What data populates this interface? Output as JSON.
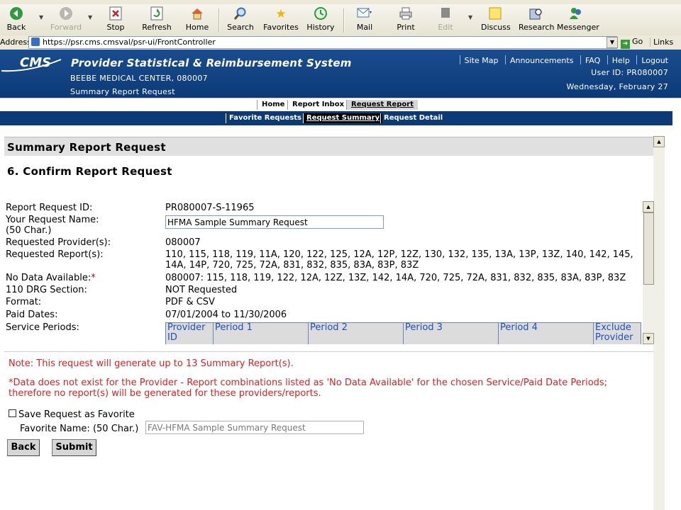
{
  "browser": {
    "toolbar": [
      {
        "label": "Back",
        "icon": "back-arrow-icon",
        "enabled": true
      },
      {
        "label": "Forward",
        "icon": "forward-arrow-icon",
        "enabled": false
      },
      {
        "label": "Stop",
        "icon": "stop-icon",
        "enabled": true
      },
      {
        "label": "Refresh",
        "icon": "refresh-icon",
        "enabled": true
      },
      {
        "label": "Home",
        "icon": "home-icon",
        "enabled": true
      },
      {
        "label": "Search",
        "icon": "search-icon",
        "enabled": true
      },
      {
        "label": "Favorites",
        "icon": "star-icon",
        "enabled": true
      },
      {
        "label": "History",
        "icon": "history-icon",
        "enabled": true
      },
      {
        "label": "Mail",
        "icon": "mail-icon",
        "enabled": true
      },
      {
        "label": "Print",
        "icon": "printer-icon",
        "enabled": true
      },
      {
        "label": "Edit",
        "icon": "edit-icon",
        "enabled": false
      },
      {
        "label": "Discuss",
        "icon": "discuss-icon",
        "enabled": true
      },
      {
        "label": "Research",
        "icon": "research-icon",
        "enabled": true
      },
      {
        "label": "Messenger",
        "icon": "messenger-icon",
        "enabled": true
      }
    ],
    "address_label": "Address",
    "url": "https://psr.cms.cmsval/psr-ui/FrontController",
    "go_label": "Go",
    "links_label": "Links"
  },
  "header": {
    "logo_text": "CMS",
    "system_title": "Provider Statistical & Reimbursement System",
    "provider": "BEEBE MEDICAL CENTER, 080007",
    "page_subtitle": "Summary Report Request",
    "top_links": [
      "Site Map",
      "Announcements",
      "FAQ",
      "Help",
      "Logout"
    ],
    "user_id": "User ID: PR080007",
    "date": "Wednesday, February 27"
  },
  "nav_primary": [
    {
      "label": "Home",
      "active": false
    },
    {
      "label": "Report Inbox",
      "active": false
    },
    {
      "label": "Request Report",
      "active": true
    }
  ],
  "nav_secondary": [
    {
      "label": "Favorite Requests",
      "active": false
    },
    {
      "label": "Request Summary",
      "active": true
    },
    {
      "label": "Request Detail",
      "active": false
    }
  ],
  "page": {
    "section_title": "Summary Report Request",
    "step_title": "6.  Confirm Report Request",
    "labels": {
      "request_id": "Report Request ID:",
      "request_name": "Your Request Name:",
      "request_name_hint": "(50 Char.)",
      "providers": "Requested Provider(s):",
      "reports": "Requested Report(s):",
      "no_data": "No Data Available:",
      "no_data_marker": "*",
      "drg": "110 DRG Section:",
      "format": "Format:",
      "paid_dates": "Paid Dates:",
      "service_periods": "Service Periods:"
    },
    "values": {
      "request_id": "PR080007-S-11965",
      "request_name": "HFMA Sample Summary Request",
      "providers": "080007",
      "reports_line1": "110, 115, 118, 119, 11A, 120, 122, 125, 12A, 12P, 12Z, 130, 132, 135, 13A, 13P, 13Z, 140, 142, 145,",
      "reports_line2": "14A, 14P, 720, 725, 72A, 831, 832, 835, 83A, 83P, 83Z",
      "no_data": "080007: 115, 118, 119, 122, 12A, 12Z, 13Z, 142, 14A, 720, 725, 72A, 831, 832, 835, 83A, 83P, 83Z",
      "drg": "NOT Requested",
      "format": "PDF & CSV",
      "paid_dates": "07/01/2004 to 11/30/2006"
    },
    "periods_columns": [
      "Provider ID",
      "Period 1",
      "Period 2",
      "Period 3",
      "Period 4",
      "Exclude Provider"
    ],
    "note1": "Note: This request will generate up to 13 Summary Report(s).",
    "note2_line1": "*Data does not exist for the Provider - Report combinations listed as 'No Data Available' for the chosen Service/Paid Date Periods;",
    "note2_line2": "therefore no report(s) will be generated for these providers/reports.",
    "save_favorite_label": "Save Request as Favorite",
    "favorite_name_label": "Favorite Name: (50 Char.)",
    "favorite_name_value": "FAV-HFMA Sample Summary Request",
    "back_label": "Back",
    "submit_label": "Submit"
  },
  "colors": {
    "header_blue": "#0c3a78",
    "note_red": "#e02020",
    "link_blue": "#1f4fc0"
  }
}
